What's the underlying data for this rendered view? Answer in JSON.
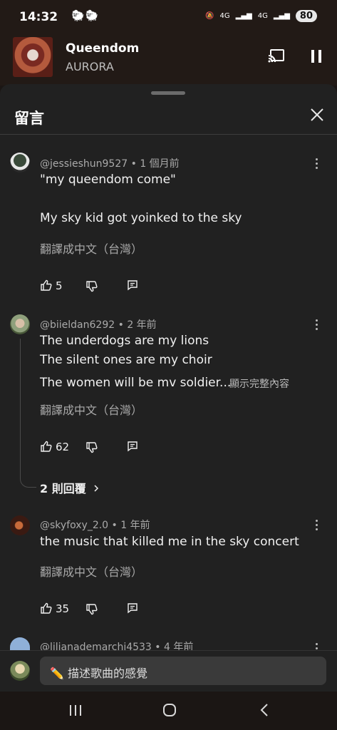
{
  "status_bar": {
    "time": "14:32",
    "battery": "80",
    "signal1": "4G",
    "signal2": "4G"
  },
  "player": {
    "song_title": "Queendom",
    "artist": "AURORA"
  },
  "sheet": {
    "title": "留言"
  },
  "comments": [
    {
      "author": "@jessieshun9527",
      "age": "1 個月前",
      "lines": [
        "\"my queendom come\"",
        "",
        "My sky kid got yoinked to the sky"
      ],
      "translate": "翻譯成中文（台灣）",
      "likes": "5"
    },
    {
      "author": "@biieldan6292",
      "age": "2 年前",
      "lines": [
        "The underdogs are my lions",
        "The silent ones are my choir",
        "The women will be mv soldier..."
      ],
      "show_more": "顯示完整內容",
      "translate": "翻譯成中文（台灣）",
      "likes": "62",
      "replies": "2 則回覆"
    },
    {
      "author": "@skyfoxy_2.0",
      "age": "1 年前",
      "lines": [
        "the music that killed me in the sky concert"
      ],
      "translate": "翻譯成中文（台灣）",
      "likes": "35"
    },
    {
      "author": "@lilianademarchi4533",
      "age": "4 年前"
    }
  ],
  "input": {
    "placeholder": "描述歌曲的感覺",
    "emoji": "✏️"
  },
  "icons": {
    "cast": "cast-icon",
    "pause": "pause-icon",
    "close": "close-icon",
    "like": "thumbs-up-icon",
    "dislike": "thumbs-down-icon",
    "reply": "reply-icon",
    "menu": "more-vert-icon",
    "chevron": "chevron-right-icon",
    "nav_recent": "recent-apps-icon",
    "nav_home": "home-icon",
    "nav_back": "back-icon"
  },
  "colors": {
    "background": "#212121",
    "header": "#221a16",
    "text": "#f1f1f1",
    "secondary": "#aaaaaa"
  }
}
